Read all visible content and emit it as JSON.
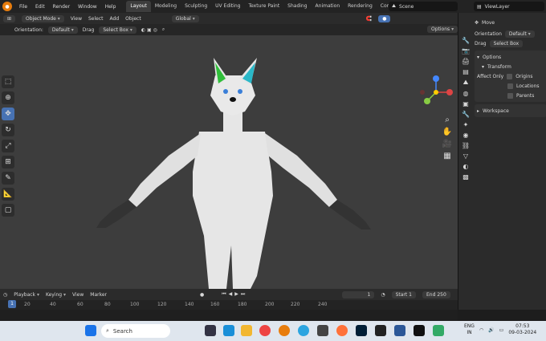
{
  "topbar": {
    "menu": [
      "File",
      "Edit",
      "Render",
      "Window",
      "Help"
    ],
    "workspaces": [
      "Layout",
      "Modeling",
      "Sculpting",
      "UV Editing",
      "Texture Paint",
      "Shading",
      "Animation",
      "Rendering",
      "Compositing"
    ],
    "active_workspace": "Layout",
    "scene": "Scene",
    "view_layer": "ViewLayer"
  },
  "viewport_header": {
    "mode": "Object Mode",
    "menus": [
      "View",
      "Select",
      "Add",
      "Object"
    ],
    "transform_orientation": "Global"
  },
  "tool_header": {
    "orientation_label": "Orientation:",
    "orientation_value": "Default",
    "drag_label": "Drag",
    "drag_value": "Select Box",
    "options": "Options"
  },
  "toolbar_tools": [
    "select-box-icon",
    "cursor-icon",
    "move-icon",
    "rotate-icon",
    "scale-icon",
    "transform-icon",
    "annotate-icon",
    "measure-icon",
    "add-cube-icon"
  ],
  "properties": {
    "tool_name": "Move",
    "orientation_label": "Orientation",
    "orientation_value": "Default",
    "drag_label": "Drag",
    "drag_value": "Select Box",
    "options_section": "Options",
    "transform_section": "Transform",
    "affect_only_label": "Affect Only",
    "affect_only": [
      "Origins",
      "Locations",
      "Parents"
    ],
    "workspace_section": "Workspace"
  },
  "timeline": {
    "menus": [
      "Playback",
      "Keying",
      "View",
      "Marker"
    ],
    "current_frame": "1",
    "start_label": "Start",
    "start": "1",
    "end_label": "End",
    "end": "250",
    "ruler_ticks": [
      "1",
      "20",
      "40",
      "60",
      "80",
      "100",
      "120",
      "140",
      "160",
      "180",
      "200",
      "220",
      "240"
    ]
  },
  "taskbar": {
    "search_placeholder": "Search",
    "lang_top": "ENG",
    "lang_bottom": "IN",
    "time": "07:53",
    "date": "09-03-2024"
  }
}
